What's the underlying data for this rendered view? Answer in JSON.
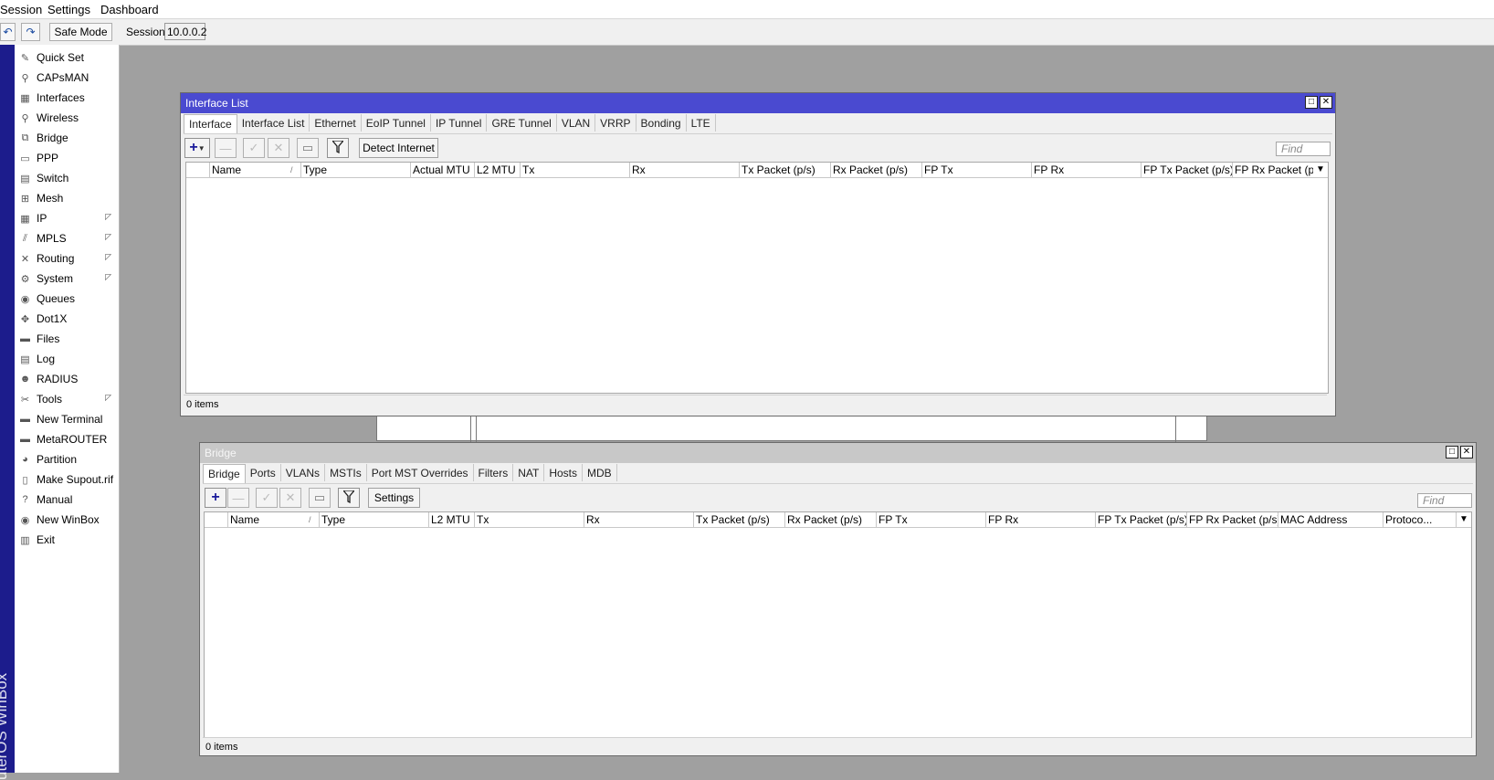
{
  "menu": {
    "session": "Session",
    "settings": "Settings",
    "dashboard": "Dashboard"
  },
  "toolbar": {
    "undo_icon": "↶",
    "redo_icon": "↷",
    "safe_mode": "Safe Mode",
    "session_label": "Session:",
    "session_value": "10.0.0.2"
  },
  "brand": "uterOS WinBox",
  "sidebar": {
    "items": [
      {
        "label": "Quick Set",
        "icon": "quick-set-icon",
        "glyph": "✎"
      },
      {
        "label": "CAPsMAN",
        "icon": "capsman-icon",
        "glyph": "⚲"
      },
      {
        "label": "Interfaces",
        "icon": "interfaces-icon",
        "glyph": "▦"
      },
      {
        "label": "Wireless",
        "icon": "wireless-icon",
        "glyph": "⚲"
      },
      {
        "label": "Bridge",
        "icon": "bridge-icon",
        "glyph": "⧉"
      },
      {
        "label": "PPP",
        "icon": "ppp-icon",
        "glyph": "▭"
      },
      {
        "label": "Switch",
        "icon": "switch-icon",
        "glyph": "▤"
      },
      {
        "label": "Mesh",
        "icon": "mesh-icon",
        "glyph": "⊞"
      },
      {
        "label": "IP",
        "icon": "ip-icon",
        "glyph": "▦",
        "arrow": "◸"
      },
      {
        "label": "MPLS",
        "icon": "mpls-icon",
        "glyph": "⫽",
        "arrow": "◸"
      },
      {
        "label": "Routing",
        "icon": "routing-icon",
        "glyph": "✕",
        "arrow": "◸"
      },
      {
        "label": "System",
        "icon": "system-icon",
        "glyph": "⚙",
        "arrow": "◸"
      },
      {
        "label": "Queues",
        "icon": "queues-icon",
        "glyph": "◉"
      },
      {
        "label": "Dot1X",
        "icon": "dot1x-icon",
        "glyph": "✥"
      },
      {
        "label": "Files",
        "icon": "files-icon",
        "glyph": "▬"
      },
      {
        "label": "Log",
        "icon": "log-icon",
        "glyph": "▤"
      },
      {
        "label": "RADIUS",
        "icon": "radius-icon",
        "glyph": "☻"
      },
      {
        "label": "Tools",
        "icon": "tools-icon",
        "glyph": "✂",
        "arrow": "◸"
      },
      {
        "label": "New Terminal",
        "icon": "terminal-icon",
        "glyph": "▬"
      },
      {
        "label": "MetaROUTER",
        "icon": "metarouter-icon",
        "glyph": "▬"
      },
      {
        "label": "Partition",
        "icon": "partition-icon",
        "glyph": "◕"
      },
      {
        "label": "Make Supout.rif",
        "icon": "supout-icon",
        "glyph": "▯"
      },
      {
        "label": "Manual",
        "icon": "manual-icon",
        "glyph": "?"
      },
      {
        "label": "New WinBox",
        "icon": "winbox-icon",
        "glyph": "◉"
      },
      {
        "label": "Exit",
        "icon": "exit-icon",
        "glyph": "▥"
      }
    ]
  },
  "interface_window": {
    "title": "Interface List",
    "tabs": [
      "Interface",
      "Interface List",
      "Ethernet",
      "EoIP Tunnel",
      "IP Tunnel",
      "GRE Tunnel",
      "VLAN",
      "VRRP",
      "Bonding",
      "LTE"
    ],
    "detect_button": "Detect Internet",
    "find_placeholder": "Find",
    "columns": [
      "Name",
      "Type",
      "Actual MTU",
      "L2 MTU",
      "Tx",
      "Rx",
      "Tx Packet (p/s)",
      "Rx Packet (p/s)",
      "FP Tx",
      "FP Rx",
      "FP Tx Packet (p/s)",
      "FP Rx Packet (p/s)"
    ],
    "status": "0 items"
  },
  "bridge_window": {
    "title": "Bridge",
    "tabs": [
      "Bridge",
      "Ports",
      "VLANs",
      "MSTIs",
      "Port MST Overrides",
      "Filters",
      "NAT",
      "Hosts",
      "MDB"
    ],
    "settings_button": "Settings",
    "find_placeholder": "Find",
    "columns": [
      "Name",
      "Type",
      "L2 MTU",
      "Tx",
      "Rx",
      "Tx Packet (p/s)",
      "Rx Packet (p/s)",
      "FP Tx",
      "FP Rx",
      "FP Tx Packet (p/s)",
      "FP Rx Packet (p/s)",
      "MAC Address",
      "Protoco..."
    ],
    "status": "0 items"
  },
  "sort_marker": "/",
  "column_menu_icon": "▼",
  "icons": {
    "add": "+",
    "remove": "—",
    "enable": "✓",
    "disable": "✕",
    "comment": "▭",
    "filter": "⚲",
    "maximize": "□",
    "close": "✕"
  }
}
